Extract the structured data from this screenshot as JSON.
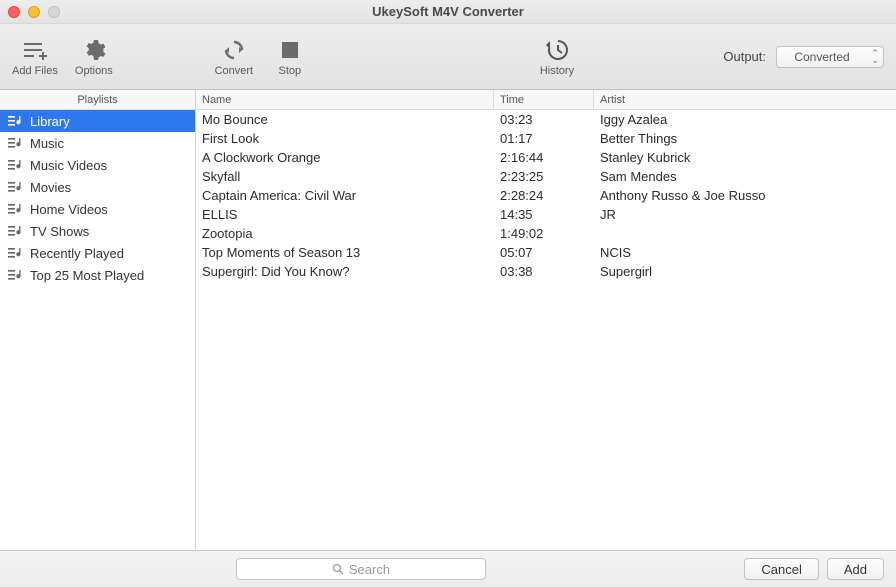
{
  "window": {
    "title": "UkeySoft M4V Converter"
  },
  "toolbar": {
    "add_files": "Add Files",
    "options": "Options",
    "convert": "Convert",
    "stop": "Stop",
    "history": "History",
    "output_label": "Output:",
    "output_value": "Converted"
  },
  "sidebar": {
    "header": "Playlists",
    "items": [
      {
        "label": "Library",
        "selected": true
      },
      {
        "label": "Music",
        "selected": false
      },
      {
        "label": "Music Videos",
        "selected": false
      },
      {
        "label": "Movies",
        "selected": false
      },
      {
        "label": "Home Videos",
        "selected": false
      },
      {
        "label": "TV Shows",
        "selected": false
      },
      {
        "label": "Recently Played",
        "selected": false
      },
      {
        "label": "Top 25 Most Played",
        "selected": false
      }
    ]
  },
  "columns": {
    "name": "Name",
    "time": "Time",
    "artist": "Artist"
  },
  "tracks": [
    {
      "name": "Mo Bounce",
      "time": "03:23",
      "artist": "Iggy Azalea"
    },
    {
      "name": "First Look",
      "time": "01:17",
      "artist": "Better Things"
    },
    {
      "name": "A Clockwork Orange",
      "time": "2:16:44",
      "artist": "Stanley Kubrick"
    },
    {
      "name": "Skyfall",
      "time": "2:23:25",
      "artist": "Sam Mendes"
    },
    {
      "name": "Captain America: Civil War",
      "time": "2:28:24",
      "artist": "Anthony Russo & Joe Russo"
    },
    {
      "name": "ELLIS",
      "time": "14:35",
      "artist": "JR"
    },
    {
      "name": "Zootopia",
      "time": "1:49:02",
      "artist": ""
    },
    {
      "name": "Top Moments of Season 13",
      "time": "05:07",
      "artist": "NCIS"
    },
    {
      "name": "Supergirl: Did You Know?",
      "time": "03:38",
      "artist": "Supergirl"
    }
  ],
  "footer": {
    "search_placeholder": "Search",
    "cancel": "Cancel",
    "add": "Add"
  }
}
